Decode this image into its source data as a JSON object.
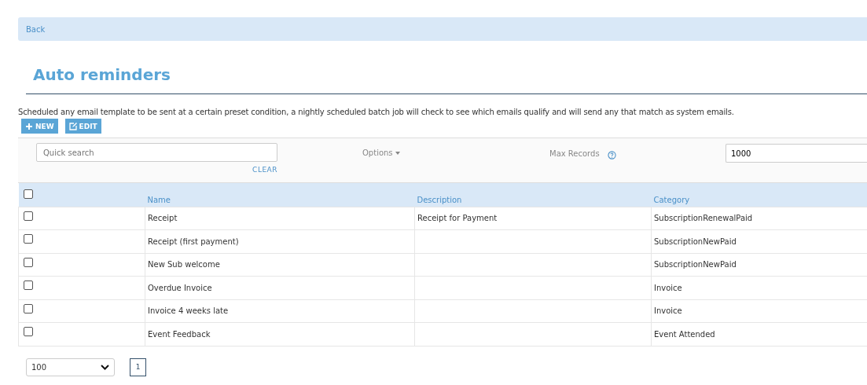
{
  "back_link": "Back",
  "title": "Auto reminders",
  "description": "Scheduled any email template to be sent at a certain preset condition, a nightly scheduled batch job will check to see which emails qualify and will send any that match as system emails.",
  "toolbar": [
    {
      "kind": "new",
      "label": "NEW"
    },
    {
      "kind": "edit",
      "label": "EDIT"
    }
  ],
  "filters": {
    "search": {
      "placeholder": "Quick search"
    },
    "clear": "CLEAR",
    "options": "Options",
    "max_records_label": "Max Records",
    "max_records": "1000"
  },
  "table": {
    "header_checked": false,
    "columns": [
      "Name",
      "Description",
      "Category"
    ],
    "rows": [
      {
        "checked": false,
        "cells": [
          "Receipt",
          "Receipt for Payment",
          "SubscriptionRenewalPaid"
        ]
      },
      {
        "checked": false,
        "cells": [
          "Receipt (first payment)",
          "",
          "SubscriptionNewPaid"
        ]
      },
      {
        "checked": false,
        "cells": [
          "New Sub welcome",
          "",
          "SubscriptionNewPaid"
        ]
      },
      {
        "checked": false,
        "cells": [
          "Overdue Invoice",
          "",
          "Invoice"
        ]
      },
      {
        "checked": false,
        "cells": [
          "Invoice 4 weeks late",
          "",
          "Invoice"
        ]
      },
      {
        "checked": false,
        "cells": [
          "Event Feedback",
          "",
          "Event Attended"
        ]
      }
    ]
  },
  "pager": {
    "page_size": "100",
    "pages": [
      {
        "label": "1",
        "selected": true
      }
    ]
  }
}
